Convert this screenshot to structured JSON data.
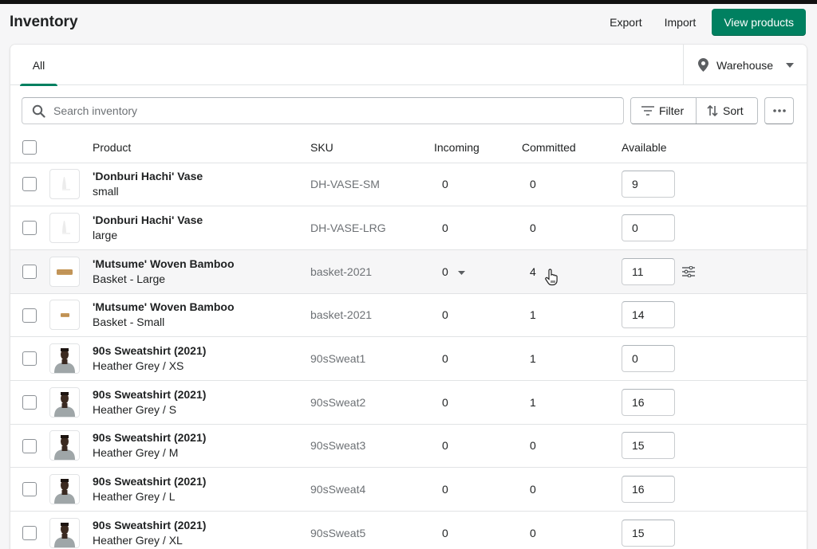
{
  "header": {
    "title": "Inventory",
    "export_label": "Export",
    "import_label": "Import",
    "view_products_label": "View products",
    "accent_color": "#008060"
  },
  "tabs": [
    {
      "label": "All",
      "selected": true
    }
  ],
  "location": {
    "label": "Warehouse",
    "icon": "location-pin-icon"
  },
  "toolbar": {
    "search_placeholder": "Search inventory",
    "search_value": "",
    "filter_label": "Filter",
    "sort_label": "Sort",
    "more_icon": "horizontal-dots-icon"
  },
  "table": {
    "columns": [
      "Product",
      "SKU",
      "Incoming",
      "Committed",
      "Available"
    ],
    "rows": [
      {
        "name": "'Donburi Hachi' Vase",
        "variant": "small",
        "sku": "DH-VASE-SM",
        "incoming": "0",
        "committed": "0",
        "available": "9",
        "thumb": "vase"
      },
      {
        "name": "'Donburi Hachi' Vase",
        "variant": "large",
        "sku": "DH-VASE-LRG",
        "incoming": "0",
        "committed": "0",
        "available": "0",
        "thumb": "vase"
      },
      {
        "name": "'Mutsume' Woven Bamboo",
        "variant": "Basket - Large",
        "sku": "basket-2021",
        "incoming": "0",
        "committed": "4",
        "available": "11",
        "thumb": "basket-large",
        "hovered": true
      },
      {
        "name": "'Mutsume' Woven Bamboo",
        "variant": "Basket - Small",
        "sku": "basket-2021",
        "incoming": "0",
        "committed": "1",
        "available": "14",
        "thumb": "basket-small"
      },
      {
        "name": "90s Sweatshirt (2021)",
        "variant": "Heather Grey / XS",
        "sku": "90sSweat1",
        "incoming": "0",
        "committed": "1",
        "available": "0",
        "thumb": "person"
      },
      {
        "name": "90s Sweatshirt (2021)",
        "variant": "Heather Grey / S",
        "sku": "90sSweat2",
        "incoming": "0",
        "committed": "1",
        "available": "16",
        "thumb": "person"
      },
      {
        "name": "90s Sweatshirt (2021)",
        "variant": "Heather Grey / M",
        "sku": "90sSweat3",
        "incoming": "0",
        "committed": "0",
        "available": "15",
        "thumb": "person"
      },
      {
        "name": "90s Sweatshirt (2021)",
        "variant": "Heather Grey / L",
        "sku": "90sSweat4",
        "incoming": "0",
        "committed": "0",
        "available": "16",
        "thumb": "person"
      },
      {
        "name": "90s Sweatshirt (2021)",
        "variant": "Heather Grey / XL",
        "sku": "90sSweat5",
        "incoming": "0",
        "committed": "0",
        "available": "15",
        "thumb": "person"
      }
    ]
  }
}
